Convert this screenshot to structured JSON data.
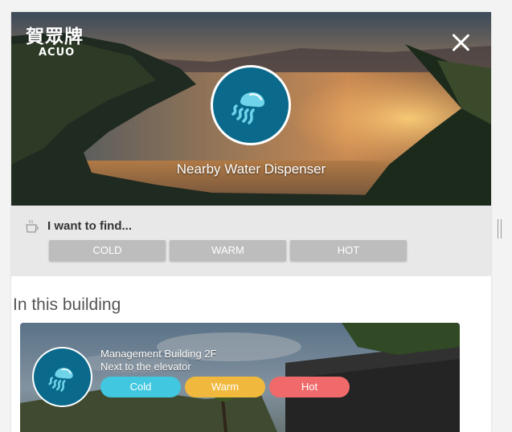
{
  "header": {
    "logo_cn": "賀眾牌",
    "logo_en": "ACUO",
    "title": "Nearby Water Dispenser"
  },
  "filter": {
    "label": "I want to find...",
    "options": [
      "COLD",
      "WARM",
      "HOT"
    ]
  },
  "section": {
    "title": "In this building"
  },
  "dispensers": [
    {
      "location": "Management Building 2F",
      "detail": "Next to the elevator",
      "temps": [
        "Cold",
        "Warm",
        "Hot"
      ]
    }
  ],
  "colors": {
    "cold": "#41c7df",
    "warm": "#f0b93e",
    "hot": "#f06a6b",
    "badge": "#0b6a8c",
    "filter_button": "#bdbdbd"
  },
  "icons": {
    "logo": "acuo-logo",
    "close": "close-icon",
    "badge": "jellyfish-icon",
    "filter": "cup-icon"
  }
}
